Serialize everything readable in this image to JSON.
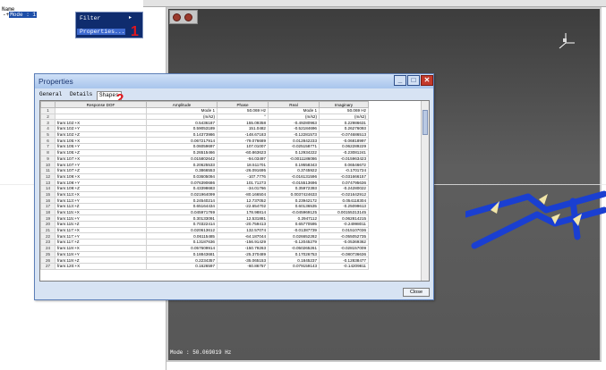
{
  "tree": {
    "header": "Name",
    "node_prefix": "-+",
    "node_selected": "Mode : 1"
  },
  "context_menu": {
    "items": [
      "Filter",
      "Properties..."
    ],
    "submenu_arrow": "▸"
  },
  "annotations": [
    "1",
    "2"
  ],
  "dialog": {
    "title": "Properties",
    "tabs": [
      "General",
      "Details",
      "Shapes"
    ],
    "close_label": "Close"
  },
  "table": {
    "headers": [
      "",
      "Response DOF",
      "Amplitude",
      "Phase",
      "Real",
      "Imaginary"
    ],
    "rows": [
      [
        "1",
        "",
        "Mode 1",
        "50.069 Hz",
        "Mode 1",
        "50.069 Hz"
      ],
      [
        "2",
        "",
        "(m/s2)",
        "°",
        "(m/s2)",
        "(m/s2)"
      ],
      [
        "3",
        "fram:102:+X",
        "0.5436187",
        "155.09358",
        "-0.49280963",
        "0.22986631"
      ],
      [
        "4",
        "fram:102:+Y",
        "0.59053189",
        "151.0482",
        "-0.52184696",
        "0.26276093"
      ],
      [
        "5",
        "fram:102:+Z",
        "0.14373986",
        "-148.67183",
        "-0.12281573",
        "-0.074686513"
      ],
      [
        "6",
        "fram:105:+X",
        "0.067217914",
        "-79.076689",
        "0.012842233",
        "-0.06818997"
      ],
      [
        "7",
        "fram:105:+Y",
        "0.06059697",
        "107.01007",
        "-0.025158771",
        "0.062289229"
      ],
      [
        "8",
        "fram:105:+Z",
        "0.26515466",
        "-60.863623",
        "0.12934222",
        "-0.23081241"
      ],
      [
        "9",
        "fram:107:+X",
        "0.015802642",
        "-94.03497",
        "-0.0011186086",
        "-0.015963423"
      ],
      [
        "10",
        "fram:107:+Y",
        "0.20625533",
        "18.511701",
        "0.19558343",
        "0.06546672"
      ],
      [
        "11",
        "fram:107:+Z",
        "0.3866553",
        "-26.091695",
        "0.3745922",
        "-0.1701724"
      ],
      [
        "12",
        "fram:109:+X",
        "0.03605094",
        "-107.7776",
        "-0.016131596",
        "-0.031666157"
      ],
      [
        "13",
        "fram:109:+Y",
        "0.076390686",
        "101.71273",
        "-0.015513696",
        "0.074795636"
      ],
      [
        "14",
        "fram:109:+Z",
        "0.43398683",
        "-34.01766",
        "0.35972393",
        "-0.24280022"
      ],
      [
        "15",
        "fram:113:+X",
        "0.021964099",
        "-80.166504",
        "0.0037424633",
        "-0.021642912"
      ],
      [
        "16",
        "fram:113:+Y",
        "0.24540214",
        "12.737052",
        "0.23942172",
        "0.054118304"
      ],
      [
        "17",
        "fram:113:+Z",
        "0.65164434",
        "-22.654702",
        "0.60136535",
        "-0.25099613"
      ],
      [
        "18",
        "fram:115:+X",
        "0.045971769",
        "178.98814",
        "-0.045969125",
        "0.00155313145"
      ],
      [
        "19",
        "fram:115:+Y",
        "0.30133091",
        "12.531881",
        "0.2947112",
        "0.062814215"
      ],
      [
        "20",
        "fram:115:+Z",
        "0.70322414",
        "-20.759413",
        "0.65770595",
        "-0.24998011"
      ],
      [
        "21",
        "fram:117:+X",
        "0.020613612",
        "132.57074",
        "-0.01387739",
        "0.015107036"
      ],
      [
        "22",
        "fram:117:+Y",
        "0.06115485",
        "-64.187044",
        "0.026652282",
        "-0.055052735"
      ],
      [
        "23",
        "fram:117:+Z",
        "0.13187636",
        "-156.91429",
        "-0.12045279",
        "-0.05369362"
      ],
      [
        "24",
        "fram:119:+X",
        "0.057609914",
        "-150.79263",
        "-0.050265261",
        "-0.028157009"
      ],
      [
        "25",
        "fram:119:+Y",
        "0.18843681",
        "-25.370489",
        "0.17026753",
        "-0.080736636"
      ],
      [
        "26",
        "fram:119:+Z",
        "0.2234357",
        "-35.065153",
        "0.1845237",
        "-0.12838477"
      ],
      [
        "27",
        "fram:120:+X",
        "0.1626597",
        "-60.86757",
        "0.079159143",
        "-0.14209811"
      ]
    ]
  },
  "statusbar": "Mode : 50.069019 Hz",
  "colors": {
    "menu_bg": "#0f2c6e",
    "menu_highlight": "#3e6ad0",
    "annotation_red": "#e1161d",
    "model_blue": "#1a3fd1",
    "arrow_yellow": "#f2e6a8"
  },
  "icons": [
    "minimize-icon",
    "maximize-icon",
    "close-icon",
    "axis-triad-icon"
  ]
}
